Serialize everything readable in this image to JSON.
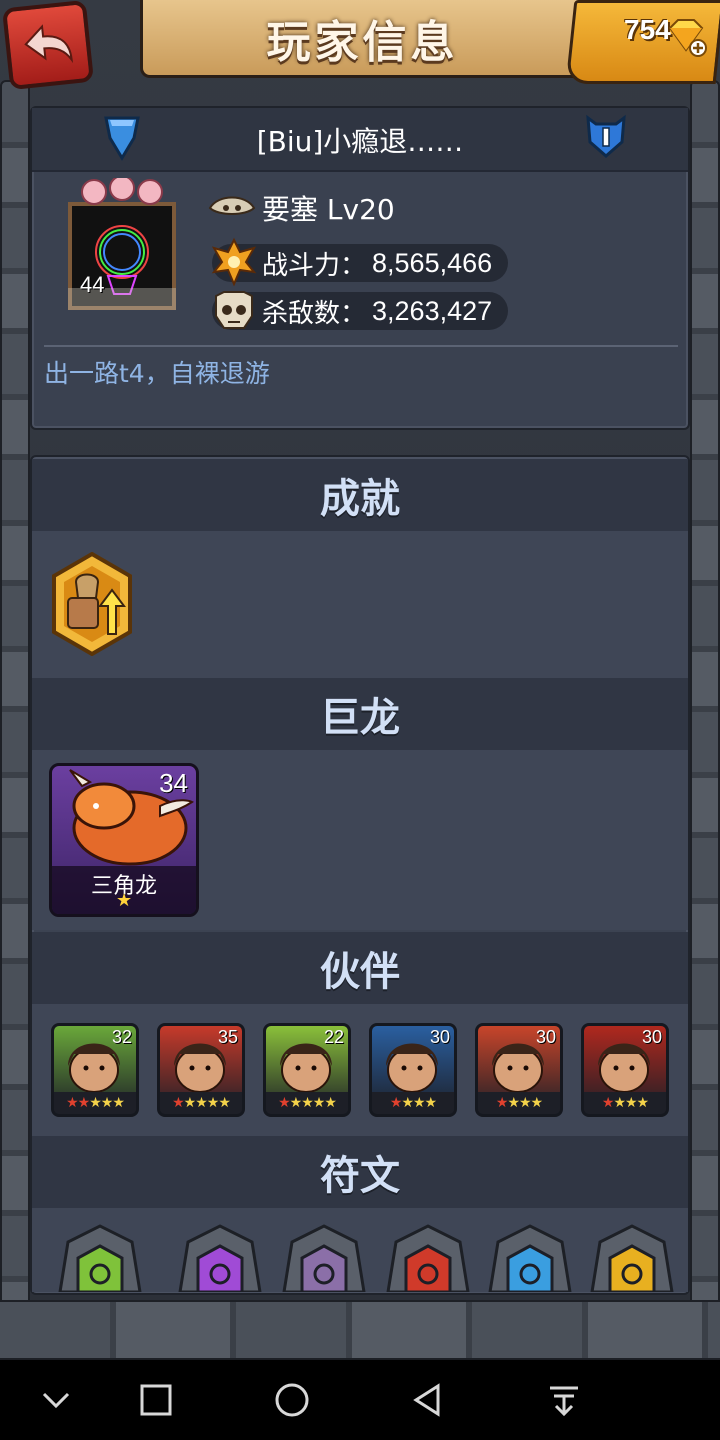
{
  "header": {
    "title": "玩家信息",
    "gems": "754",
    "back_icon": "back-arrow-icon",
    "gem_icon": "diamond-icon"
  },
  "profile": {
    "name": "[Biu]小瘾退……",
    "avatar_level": "44",
    "fort_label": "要塞 Lv20",
    "power_label": "战斗力：",
    "power_value": "8,565,466",
    "kills_label": "杀敌数：",
    "kills_value": "3,263,427",
    "motto": "出一路t4，自裸退游"
  },
  "sections": {
    "achievements": "成就",
    "dragons": "巨龙",
    "partners": "伙伴",
    "runes": "符文"
  },
  "dragon": {
    "name": "三角龙",
    "level": "34",
    "stars": "★"
  },
  "heroes": [
    {
      "level": "32",
      "stars_red": "★★",
      "stars_gold": "★★★",
      "color": "#6aa83a"
    },
    {
      "level": "35",
      "stars_red": "★",
      "stars_gold": "★★★★",
      "color": "#c63a2a"
    },
    {
      "level": "22",
      "stars_red": "★",
      "stars_gold": "★★★★",
      "color": "#8ac03a"
    },
    {
      "level": "30",
      "stars_red": "★",
      "stars_gold": "★★★",
      "color": "#2a5fa0"
    },
    {
      "level": "30",
      "stars_red": "★",
      "stars_gold": "★★★",
      "color": "#c8452a"
    },
    {
      "level": "30",
      "stars_red": "★",
      "stars_gold": "★★★",
      "color": "#b0281e"
    }
  ],
  "runes": [
    {
      "color": "#7fc23a",
      "icon": "sun-rune-icon"
    },
    {
      "color": "#a04bd6",
      "icon": "ring-rune-icon"
    },
    {
      "color": "#8b6fa8",
      "icon": "wave-rune-icon"
    },
    {
      "color": "#d03a2a",
      "icon": "cross-rune-icon"
    },
    {
      "color": "#3a9ee0",
      "icon": "dots-rune-icon"
    },
    {
      "color": "#e8b020",
      "icon": "eye-rune-icon"
    }
  ],
  "colors": {
    "accent_gold": "#f5b83a",
    "section_text": "#d2e0f6",
    "motto_text": "#8fb4e4"
  }
}
